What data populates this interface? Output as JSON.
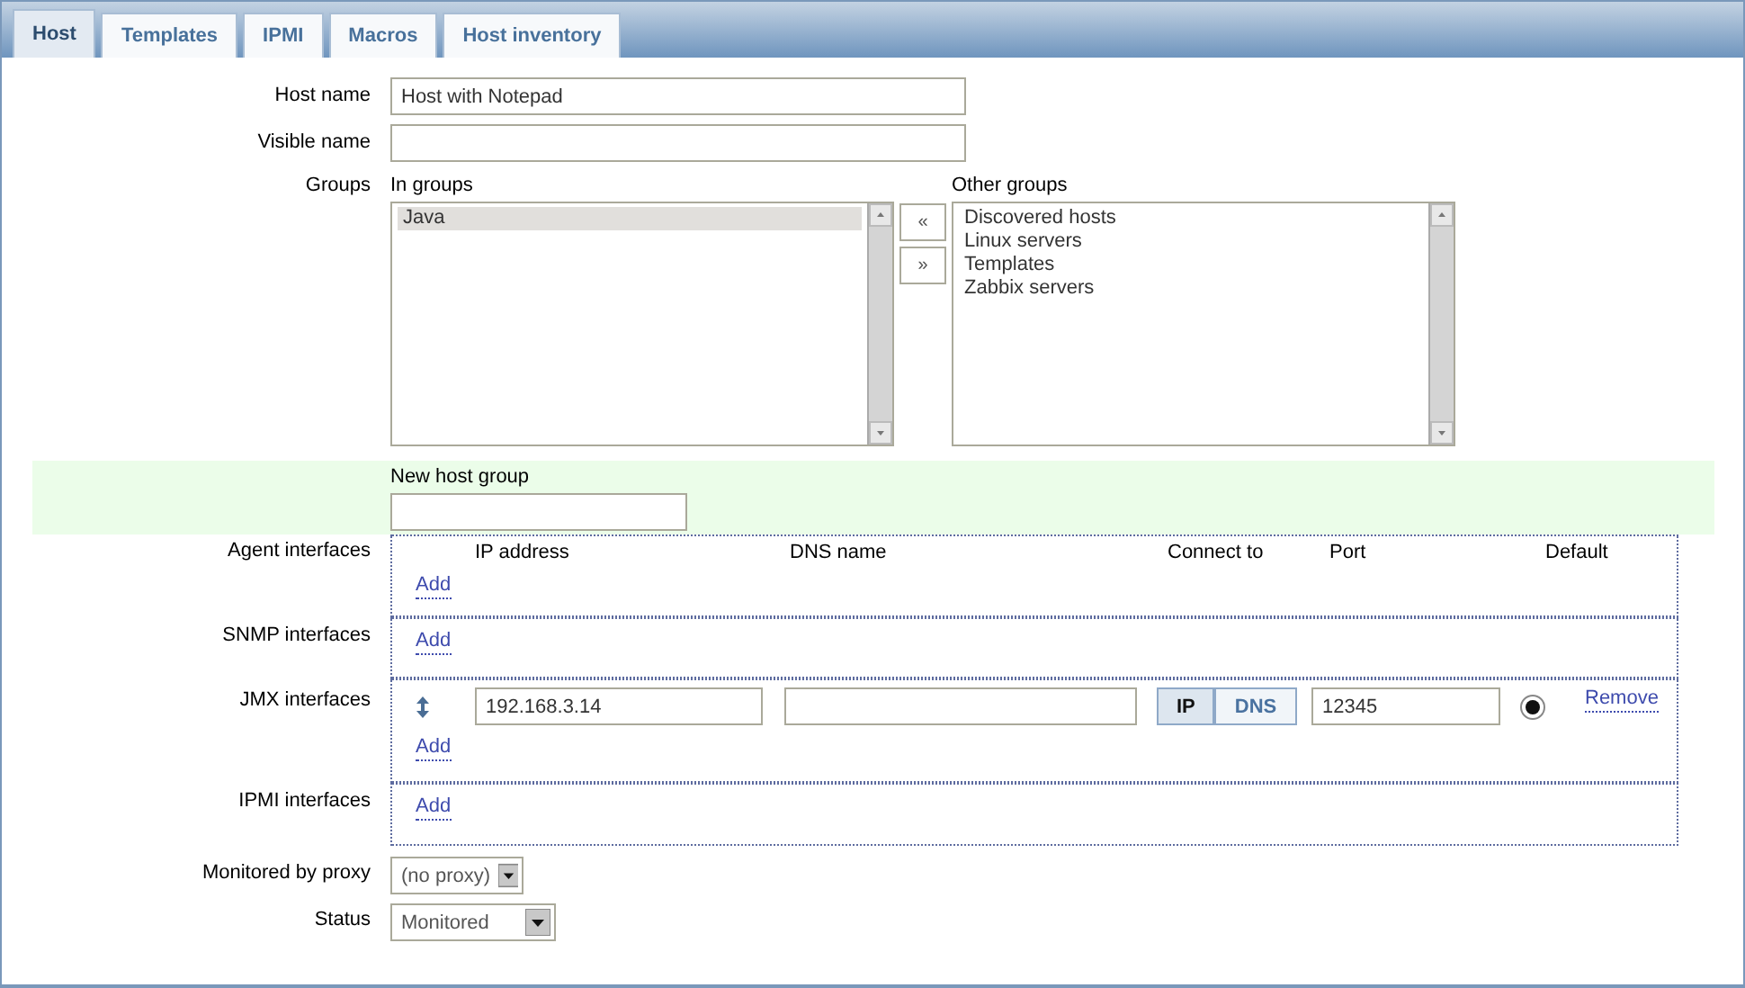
{
  "tabs": [
    {
      "label": "Host",
      "selected": true
    },
    {
      "label": "Templates",
      "selected": false
    },
    {
      "label": "IPMI",
      "selected": false
    },
    {
      "label": "Macros",
      "selected": false
    },
    {
      "label": "Host inventory",
      "selected": false
    }
  ],
  "host_name": {
    "label": "Host name",
    "value": "Host with Notepad"
  },
  "visible_name": {
    "label": "Visible name"
  },
  "groups": {
    "label": "Groups",
    "move_buttons": [
      "«",
      "»"
    ],
    "in_groups": {
      "label": "In groups",
      "items": [
        {
          "text": "Java",
          "selected": true
        }
      ]
    },
    "other_groups": {
      "label": "Other groups",
      "items": [
        {
          "text": "Discovered hosts",
          "selected": false
        },
        {
          "text": "Linux servers",
          "selected": false
        },
        {
          "text": "Templates",
          "selected": false
        },
        {
          "text": "Zabbix servers",
          "selected": false
        }
      ]
    }
  },
  "new_host_group": {
    "label": "New host group"
  },
  "interfaces": [
    {
      "label": "Agent interfaces",
      "columns": [
        "IP address",
        "DNS name",
        "Connect to",
        "Port",
        "Default"
      ],
      "add_link": "Add"
    },
    {
      "label": "SNMP interfaces",
      "add_link": "Add"
    },
    {
      "label": "JMX interfaces",
      "add_link": "Add",
      "rows": [
        {
          "ip": "192.168.3.14",
          "connect_to": [
            {
              "label": "IP",
              "selected": true
            },
            {
              "label": "DNS",
              "selected": false
            }
          ],
          "port": "12345",
          "default": true,
          "remove": "Remove"
        }
      ]
    },
    {
      "label": "IPMI interfaces",
      "add_link": "Add"
    }
  ],
  "proxy": {
    "label": "Monitored by proxy",
    "value": "(no proxy)"
  },
  "status": {
    "label": "Status",
    "value": "Monitored"
  }
}
